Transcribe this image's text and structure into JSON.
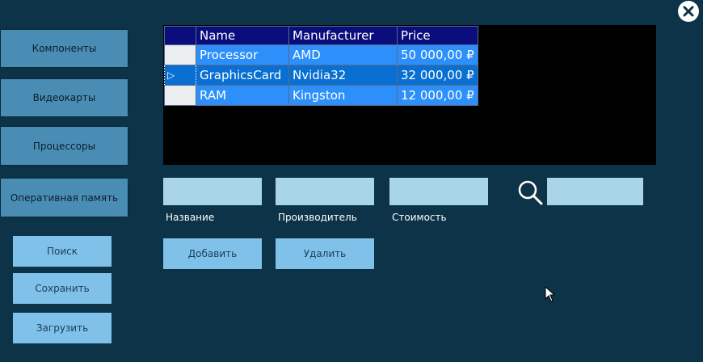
{
  "window": {
    "close_icon": "close-icon"
  },
  "nav": [
    {
      "label": "Компоненты"
    },
    {
      "label": "Видеокарты"
    },
    {
      "label": "Процессоры"
    },
    {
      "label": "Оперативная память"
    }
  ],
  "actions": {
    "search": "Поиск",
    "save": "Сохранить",
    "load": "Загрузить"
  },
  "grid": {
    "columns": [
      "Name",
      "Manufacturer",
      "Price"
    ],
    "rows": [
      {
        "name": "Processor",
        "manufacturer": "AMD",
        "price": "50 000,00 ₽",
        "selected": false
      },
      {
        "name": "GraphicsCard",
        "manufacturer": "Nvidia32",
        "price": "32 000,00 ₽",
        "selected": true
      },
      {
        "name": "RAM",
        "manufacturer": "Kingston",
        "price": "12 000,00 ₽",
        "selected": false
      }
    ],
    "selected_row_marker": "▷"
  },
  "form": {
    "name_label": "Название",
    "manufacturer_label": "Производитель",
    "price_label": "Стоимость",
    "name_value": "",
    "manufacturer_value": "",
    "price_value": "",
    "search_value": "",
    "search_icon": "magnifier-icon",
    "add_label": "Добавить",
    "delete_label": "Удалить"
  },
  "colors": {
    "background": "#0c3347",
    "nav_button": "#4a8db4",
    "action_button": "#7fc1e8",
    "input_field": "#a8d6e7",
    "grid_header": "#0a0d7c",
    "grid_row": "#2d8ffa",
    "grid_selected": "#0a6fd2"
  }
}
